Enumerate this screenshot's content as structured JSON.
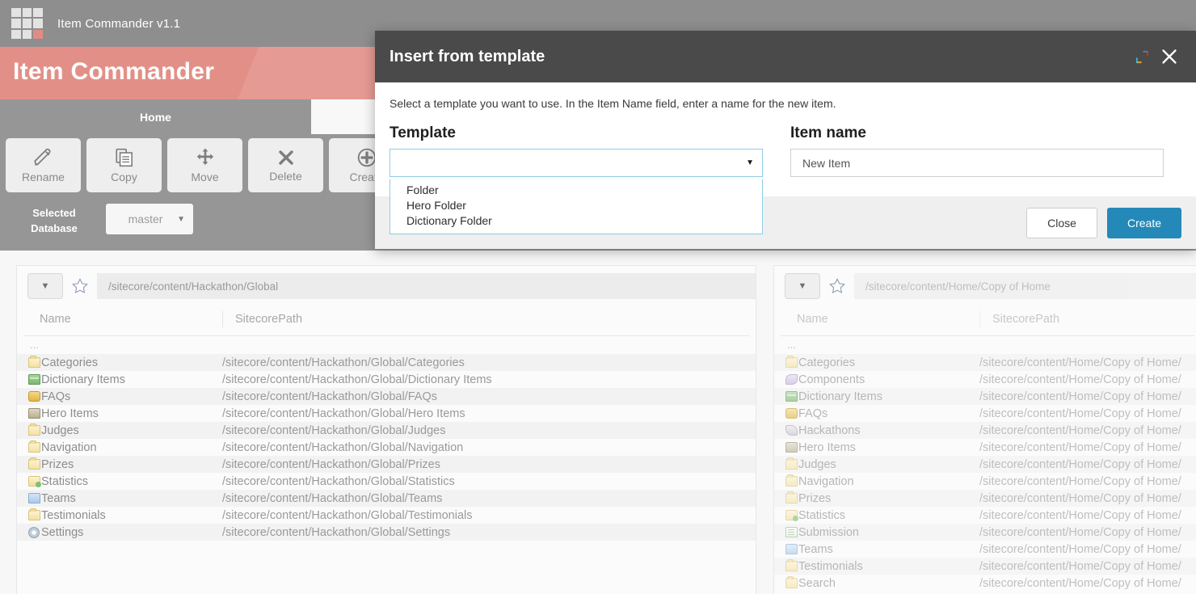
{
  "app": {
    "window_title": "Item Commander v1.1",
    "banner_title": "Item Commander",
    "logo_icon": "grid-3x3-icon"
  },
  "tabs": [
    {
      "label": "Home",
      "active": true
    },
    {
      "label": "",
      "active": false
    }
  ],
  "ribbon": {
    "buttons": [
      {
        "label": "Rename",
        "icon": "pencil-icon"
      },
      {
        "label": "Copy",
        "icon": "copy-icon"
      },
      {
        "label": "Move",
        "icon": "move-arrows-icon"
      },
      {
        "label": "Delete",
        "icon": "cross-icon"
      },
      {
        "label": "Create",
        "icon": "plus-circle-icon"
      }
    ]
  },
  "database_bar": {
    "label": "Selected Database",
    "selected": "master",
    "caret_icon": "caret-down-icon"
  },
  "panels": {
    "columns": {
      "name": "Name",
      "path": "SitecorePath"
    },
    "parent_row": "...",
    "left": {
      "path": "/sitecore/content/Hackathon/Global",
      "dropdown_icon": "caret-down-icon",
      "favorite_icon": "star-icon",
      "rows": [
        {
          "name": "Categories",
          "icon": "folder-icon",
          "path": "/sitecore/content/Hackathon/Global/Categories"
        },
        {
          "name": "Dictionary Items",
          "icon": "books-icon",
          "path": "/sitecore/content/Hackathon/Global/Dictionary Items"
        },
        {
          "name": "FAQs",
          "icon": "faq-icon",
          "path": "/sitecore/content/Hackathon/Global/FAQs"
        },
        {
          "name": "Hero Items",
          "icon": "hero-icon",
          "path": "/sitecore/content/Hackathon/Global/Hero Items"
        },
        {
          "name": "Judges",
          "icon": "folder-icon",
          "path": "/sitecore/content/Hackathon/Global/Judges"
        },
        {
          "name": "Navigation",
          "icon": "folder-icon",
          "path": "/sitecore/content/Hackathon/Global/Navigation"
        },
        {
          "name": "Prizes",
          "icon": "folder-icon",
          "path": "/sitecore/content/Hackathon/Global/Prizes"
        },
        {
          "name": "Statistics",
          "icon": "stats-folder-icon",
          "path": "/sitecore/content/Hackathon/Global/Statistics"
        },
        {
          "name": "Teams",
          "icon": "teams-icon",
          "path": "/sitecore/content/Hackathon/Global/Teams"
        },
        {
          "name": "Testimonials",
          "icon": "folder-icon",
          "path": "/sitecore/content/Hackathon/Global/Testimonials"
        },
        {
          "name": "Settings",
          "icon": "gear-icon",
          "path": "/sitecore/content/Hackathon/Global/Settings"
        }
      ]
    },
    "right": {
      "path": "/sitecore/content/Home/Copy of Home",
      "dropdown_icon": "caret-down-icon",
      "favorite_icon": "star-icon",
      "rows": [
        {
          "name": "Categories",
          "icon": "folder-icon",
          "path": "/sitecore/content/Home/Copy of Home/"
        },
        {
          "name": "Components",
          "icon": "component-icon",
          "path": "/sitecore/content/Home/Copy of Home/"
        },
        {
          "name": "Dictionary Items",
          "icon": "books-icon",
          "path": "/sitecore/content/Home/Copy of Home/"
        },
        {
          "name": "FAQs",
          "icon": "faq-icon",
          "path": "/sitecore/content/Home/Copy of Home/"
        },
        {
          "name": "Hackathons",
          "icon": "hackathon-icon",
          "path": "/sitecore/content/Home/Copy of Home/"
        },
        {
          "name": "Hero Items",
          "icon": "hero-icon",
          "path": "/sitecore/content/Home/Copy of Home/"
        },
        {
          "name": "Judges",
          "icon": "folder-icon",
          "path": "/sitecore/content/Home/Copy of Home/"
        },
        {
          "name": "Navigation",
          "icon": "folder-icon",
          "path": "/sitecore/content/Home/Copy of Home/"
        },
        {
          "name": "Prizes",
          "icon": "folder-icon",
          "path": "/sitecore/content/Home/Copy of Home/"
        },
        {
          "name": "Statistics",
          "icon": "stats-folder-icon",
          "path": "/sitecore/content/Home/Copy of Home/"
        },
        {
          "name": "Submission",
          "icon": "submission-icon",
          "path": "/sitecore/content/Home/Copy of Home/"
        },
        {
          "name": "Teams",
          "icon": "teams-icon",
          "path": "/sitecore/content/Home/Copy of Home/"
        },
        {
          "name": "Testimonials",
          "icon": "folder-icon",
          "path": "/sitecore/content/Home/Copy of Home/"
        },
        {
          "name": "Search",
          "icon": "folder-icon",
          "path": "/sitecore/content/Home/Copy of Home/"
        }
      ]
    }
  },
  "modal": {
    "title": "Insert from template",
    "restore_icon": "restore-window-icon",
    "close_icon": "close-x-icon",
    "intro": "Select a template you want to use. In the Item Name field, enter a name for the new item.",
    "template": {
      "label": "Template",
      "selected": "",
      "caret_icon": "caret-down-icon",
      "options": [
        "Folder",
        "Hero Folder",
        "Dictionary Folder"
      ]
    },
    "item_name": {
      "label": "Item name",
      "value": "New Item"
    },
    "buttons": {
      "close": "Close",
      "create": "Create"
    }
  },
  "colors": {
    "banner": "#e29087",
    "chrome_gray": "#969696",
    "modal_header": "#4a4a4a",
    "primary_button": "#2489b8",
    "select_border": "#8fcbe3"
  }
}
